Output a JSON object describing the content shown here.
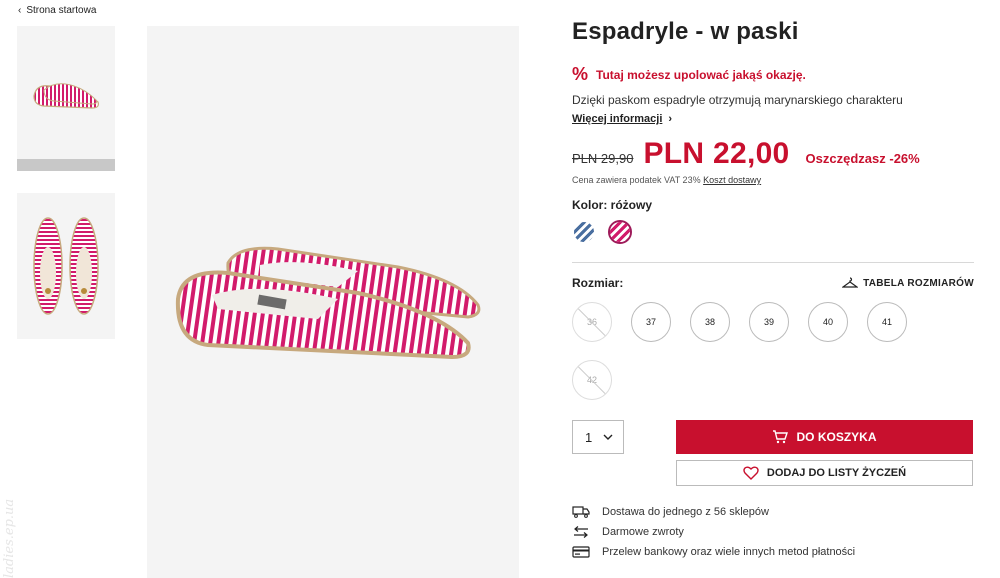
{
  "breadcrumb": {
    "label": "Strona startowa"
  },
  "product": {
    "title": "Espadryle - w paski",
    "promo_text": "Tutaj możesz upolować jakąś okazję.",
    "promo_symbol": "%",
    "description": "Dzięki paskom espadryle otrzymują marynarskiego charakteru",
    "more_info": "Więcej informacji",
    "old_price": "PLN 29,90",
    "new_price": "PLN 22,00",
    "savings": "Oszczędzasz -26%",
    "vat_text": "Cena zawiera podatek VAT 23%",
    "shipping_link": "Koszt dostawy",
    "color_label": "Kolor: różowy",
    "colors": [
      {
        "name": "blue-striped",
        "hex": "#4a6fa0",
        "active": false
      },
      {
        "name": "pink-striped",
        "hex": "#d21b6b",
        "active": true
      }
    ],
    "size_label": "Rozmiar:",
    "size_table": "TABELA ROZMIARÓW",
    "sizes": [
      {
        "label": "36",
        "available": false
      },
      {
        "label": "37",
        "available": true
      },
      {
        "label": "38",
        "available": true
      },
      {
        "label": "39",
        "available": true
      },
      {
        "label": "40",
        "available": true
      },
      {
        "label": "41",
        "available": true
      },
      {
        "label": "42",
        "available": false
      }
    ],
    "quantity": "1",
    "add_to_cart": "DO KOSZYKA",
    "add_to_wishlist": "DODAJ DO LISTY ŻYCZEŃ"
  },
  "info": [
    {
      "icon": "truck-icon",
      "text": "Dostawa do jednego z 56 sklepów"
    },
    {
      "icon": "return-arrow-icon",
      "text": "Darmowe zwroty"
    },
    {
      "icon": "card-icon",
      "text": "Przelew bankowy oraz wiele innych metod płatności"
    }
  ],
  "colors": {
    "accent": "#c8102e",
    "shoe": "#d21b6b",
    "background_image": "#f4f4f4"
  },
  "watermark": "ladies.ep.ua"
}
